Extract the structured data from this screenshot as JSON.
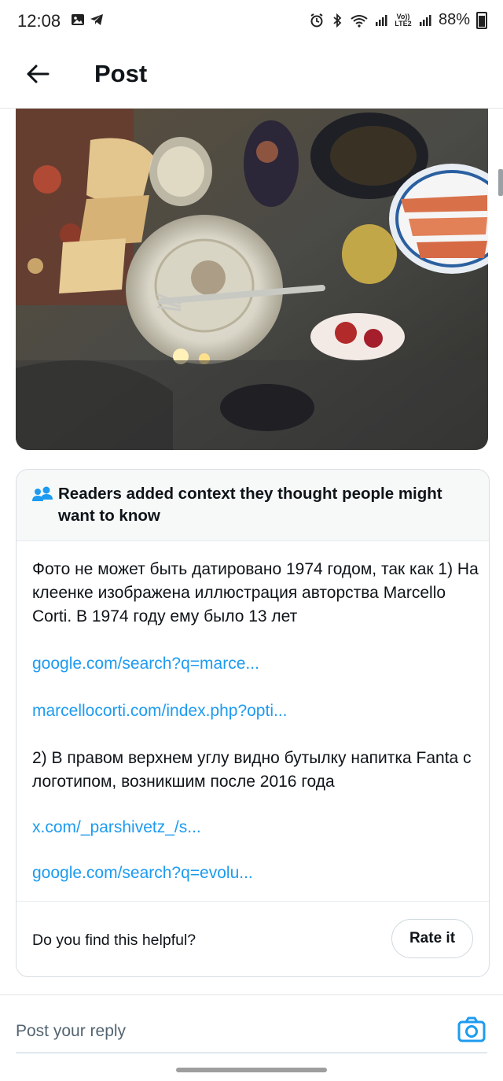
{
  "status_bar": {
    "time": "12:08",
    "battery": "88%",
    "icons": [
      "gallery-icon",
      "telegram-icon",
      "alarm-icon",
      "bluetooth-icon",
      "wifi-icon",
      "signal-icon",
      "volte-icon",
      "battery-icon"
    ],
    "volte_label": "Vo)) LTE2"
  },
  "header": {
    "title": "Post",
    "back_icon": "arrow-left-icon"
  },
  "note": {
    "header_text": "Readers added context they thought people might want to know",
    "header_icon": "people-icon",
    "paragraph_1": "Фото не может быть датировано 1974 годом, так как 1) На клеенке изображена иллюстрация авторства Marcello Corti. В 1974 году ему было 13 лет",
    "link_1": "google.com/search?q=marce...",
    "link_2": "marcellocorti.com/index.php?opti...",
    "paragraph_2": "2) В правом верхнем углу видно бутылку напитка Fanta с логотипом, возникшим после 2016 года",
    "link_3": "x.com/_parshivetz_/s...",
    "link_4": "google.com/search?q=evolu...",
    "helpful_prompt": "Do you find this helpful?",
    "rate_button": "Rate it"
  },
  "reply": {
    "placeholder": "Post your reply",
    "camera_icon": "camera-icon"
  },
  "colors": {
    "link": "#1d9bf0",
    "text": "#0f1419",
    "muted": "#536471",
    "border": "#d8dee3"
  }
}
